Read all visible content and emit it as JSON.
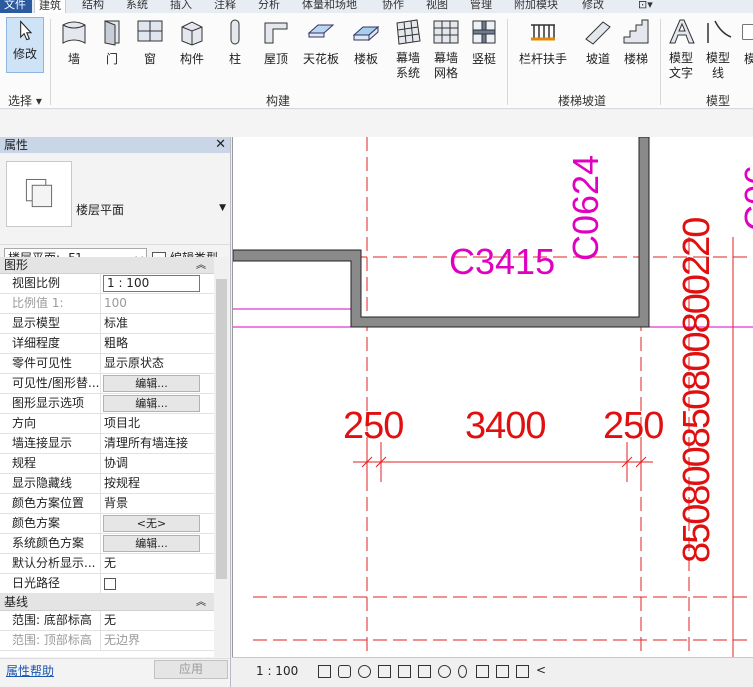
{
  "tabs": [
    "文件",
    "建筑",
    "结构",
    "系统",
    "插入",
    "注释",
    "分析",
    "体量和场地",
    "协作",
    "视图",
    "管理",
    "附加模块",
    "修改",
    "⊡▾"
  ],
  "ribbon": {
    "select": {
      "label": "修改",
      "panel": "选择 ▾"
    },
    "build_tools": [
      "墙",
      "门",
      "窗",
      "构件",
      "柱",
      "屋顶",
      "天花板",
      "楼板",
      "幕墙\n系统",
      "幕墙\n网格",
      "竖梃"
    ],
    "build_panel": "构建",
    "stair_tools": [
      "栏杆扶手",
      "坡道",
      "楼梯"
    ],
    "stair_panel": "楼梯坡道",
    "model_tools": [
      "模型\n文字",
      "模型\n线",
      "模"
    ],
    "model_panel": "模型"
  },
  "properties": {
    "title": "属性",
    "close": "✕",
    "type_name": "楼层平面",
    "instance": "楼层平面: -F1",
    "edit_type": "编辑类型",
    "groups": [
      {
        "name": "图形",
        "rows": [
          {
            "name": "视图比例",
            "value": "1 : 100",
            "kind": "box"
          },
          {
            "name": "比例值 1:",
            "value": "100",
            "kind": "dim"
          },
          {
            "name": "显示模型",
            "value": "标准",
            "kind": "text"
          },
          {
            "name": "详细程度",
            "value": "粗略",
            "kind": "text"
          },
          {
            "name": "零件可见性",
            "value": "显示原状态",
            "kind": "text"
          },
          {
            "name": "可见性/图形替...",
            "value": "编辑...",
            "kind": "button"
          },
          {
            "name": "图形显示选项",
            "value": "编辑...",
            "kind": "button"
          },
          {
            "name": "方向",
            "value": "项目北",
            "kind": "text"
          },
          {
            "name": "墙连接显示",
            "value": "清理所有墙连接",
            "kind": "text"
          },
          {
            "name": "规程",
            "value": "协调",
            "kind": "text"
          },
          {
            "name": "显示隐藏线",
            "value": "按规程",
            "kind": "text"
          },
          {
            "name": "颜色方案位置",
            "value": "背景",
            "kind": "text"
          },
          {
            "name": "颜色方案",
            "value": "<无>",
            "kind": "button"
          },
          {
            "name": "系统颜色方案",
            "value": "编辑...",
            "kind": "button"
          },
          {
            "name": "默认分析显示...",
            "value": "无",
            "kind": "text"
          },
          {
            "name": "日光路径",
            "value": "",
            "kind": "checkbox"
          }
        ]
      },
      {
        "name": "基线",
        "rows": [
          {
            "name": "范围: 底部标高",
            "value": "无",
            "kind": "text"
          },
          {
            "name": "范围: 顶部标高",
            "value": "无边界",
            "kind": "dimval"
          }
        ]
      }
    ],
    "help": "属性帮助",
    "apply": "应用"
  },
  "drawing": {
    "dims_h": [
      "250",
      "3400",
      "250"
    ],
    "dims_v": "850800850800800220",
    "tag_window": "C3415",
    "tag_window_v": "C0624",
    "tag_edge": "C06"
  },
  "status": {
    "scale": "1 : 100"
  }
}
